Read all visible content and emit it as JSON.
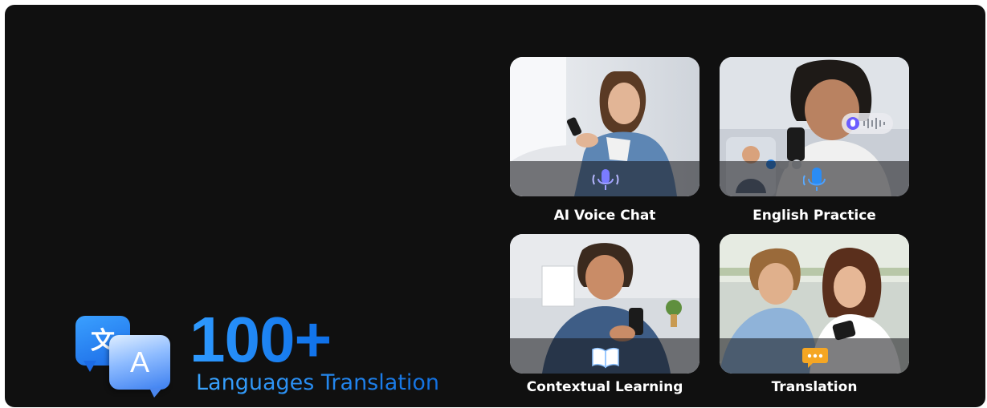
{
  "headline": {
    "translate_glyph": "文",
    "letter_glyph": "A",
    "number": "100+",
    "subtitle": "Languages Translation"
  },
  "cards": [
    {
      "label": "AI Voice Chat",
      "icon": "microphone-icon"
    },
    {
      "label": "English Practice",
      "icon": "microphone-icon"
    },
    {
      "label": "Contextual Learning",
      "icon": "open-book-icon"
    },
    {
      "label": "Translation",
      "icon": "chat-bubble-icon"
    }
  ],
  "colors": {
    "background": "#101010",
    "accent_blue": "#1c7ef0",
    "label_text": "#ffffff"
  }
}
